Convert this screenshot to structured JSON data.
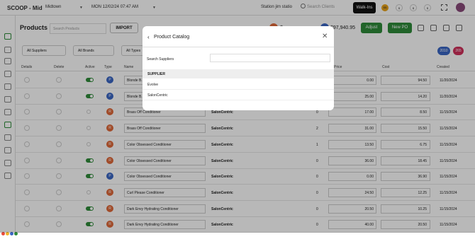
{
  "topbar": {
    "app_name": "SCOOP - Mid",
    "location": "Midtown",
    "datetime": "MON 12/02/24  07:47 AM",
    "station": "Station jim statio",
    "search_placeholder": "Search Clients",
    "walkin": "Walk-Ins",
    "coin_labels": [
      "$$",
      "$",
      "$",
      "$"
    ]
  },
  "header": {
    "title": "Products",
    "search_placeholder": "Search Products",
    "import": "IMPORT",
    "total_a": "$...",
    "total_b": "$97,940.95",
    "adjust": "Adjust",
    "new_po": "New PO"
  },
  "filters": {
    "suppliers": "All Suppliers",
    "brands": "All Brands",
    "types": "All Types",
    "pill_a": "2010",
    "pill_b": "265"
  },
  "table": {
    "headers": [
      "Details",
      "Delete",
      "Active",
      "Type",
      "Name",
      "Price",
      "Cost",
      "Created"
    ],
    "rows": [
      {
        "type": "P",
        "name": "Blonde B...",
        "supplier": "",
        "qty": "",
        "price": "0.00",
        "cost": "94.50",
        "created": "11/20/2024",
        "active": true
      },
      {
        "type": "P",
        "name": "Blonde B...",
        "supplier": "",
        "qty": "",
        "price": "25.00",
        "cost": "14.20",
        "created": "11/20/2024",
        "active": true
      },
      {
        "type": "R",
        "name": "Brass Off Conditioner",
        "supplier": "SalonCentric",
        "qty": "0",
        "price": "17.00",
        "cost": "8.50",
        "created": "11/15/2024",
        "active": false
      },
      {
        "type": "R",
        "name": "Brass Off Conditioner",
        "supplier": "SalonCentric",
        "qty": "2",
        "price": "31.00",
        "cost": "15.50",
        "created": "11/15/2024",
        "active": false
      },
      {
        "type": "R",
        "name": "Color Obsessed Conditioner",
        "supplier": "SalonCentric",
        "qty": "1",
        "price": "13.50",
        "cost": "6.75",
        "created": "11/15/2024",
        "active": false
      },
      {
        "type": "R",
        "name": "Color Obsessed Conditioner",
        "supplier": "SalonCentric",
        "qty": "0",
        "price": "36.00",
        "cost": "18.45",
        "created": "11/15/2024",
        "active": true
      },
      {
        "type": "P",
        "name": "Color Obsessed Conditioner",
        "supplier": "SalonCentric",
        "qty": "0",
        "price": "0.00",
        "cost": "36.90",
        "created": "11/15/2024",
        "active": true
      },
      {
        "type": "R",
        "name": "Curl Please Conditioner",
        "supplier": "SalonCentric",
        "qty": "0",
        "price": "24.50",
        "cost": "12.25",
        "created": "11/15/2024",
        "active": false
      },
      {
        "type": "R",
        "name": "Dark Envy Hydrating Conditioner",
        "supplier": "SalonCentric",
        "qty": "0",
        "price": "20.50",
        "cost": "10.25",
        "created": "11/15/2024",
        "active": true
      },
      {
        "type": "R",
        "name": "Dark Envy Hydrating Conditioner",
        "supplier": "SalonCentric",
        "qty": "0",
        "price": "40.00",
        "cost": "20.50",
        "created": "11/15/2024",
        "active": true
      }
    ]
  },
  "modal": {
    "title": "Product Catalog",
    "search_label": "Search Suppliers",
    "section_header": "SUPPLIER",
    "items": [
      "Evolve",
      "SalonCentric"
    ]
  },
  "colors": {
    "accent": "#2e8b3a",
    "badge_p": "#3a66c4",
    "badge_r": "#e0693a"
  }
}
